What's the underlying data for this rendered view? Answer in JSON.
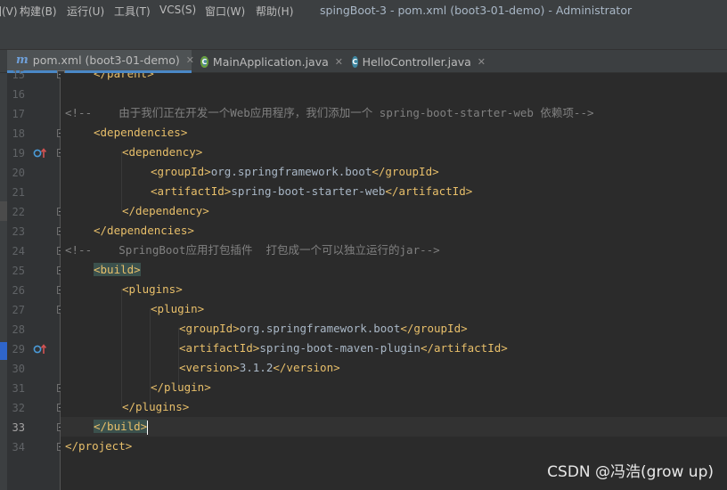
{
  "menu": [
    "图(V)",
    "构建(B)",
    "运行(U)",
    "工具(T)",
    "VCS(S)",
    "窗口(W)",
    "帮助(H)"
  ],
  "window_title": "spingBoot-3 - pom.xml (boot3-01-demo) - Administrator",
  "tabs": [
    {
      "label": "pom.xml (boot3-01-demo)",
      "icon": "maven-icon",
      "active": true
    },
    {
      "label": "MainApplication.java",
      "icon": "spring-class-icon",
      "active": false
    },
    {
      "label": "HelloController.java",
      "icon": "class-icon",
      "active": false
    }
  ],
  "gutter": {
    "lines": [
      "15",
      "16",
      "17",
      "18",
      "19",
      "20",
      "21",
      "22",
      "23",
      "24",
      "25",
      "26",
      "27",
      "28",
      "29",
      "30",
      "31",
      "32",
      "33",
      "34"
    ],
    "current_line": "33"
  },
  "code": {
    "l15": "</parent>",
    "l17": "<!--    由于我们正在开发一个Web应用程序，我们添加一个 spring-boot-starter-web 依赖项-->",
    "l18": "<dependencies>",
    "l19": "<dependency>",
    "l20_open": "<groupId>",
    "l20_val": "org.springframework.boot",
    "l20_close": "</groupId>",
    "l21_open": "<artifactId>",
    "l21_val": "spring-boot-starter-web",
    "l21_close": "</artifactId>",
    "l22": "</dependency>",
    "l23": "</dependencies>",
    "l24": "<!--    SpringBoot应用打包插件  打包成一个可以独立运行的jar-->",
    "l25": "<build>",
    "l26": "<plugins>",
    "l27": "<plugin>",
    "l28_open": "<groupId>",
    "l28_val": "org.springframework.boot",
    "l28_close": "</groupId>",
    "l29_open": "<artifactId>",
    "l29_val": "spring-boot-maven-plugin",
    "l29_close": "</artifactId>",
    "l30_open": "<version>",
    "l30_val": "3.1.2",
    "l30_close": "</version>",
    "l31": "</plugin>",
    "l32": "</plugins>",
    "l33": "</build>",
    "l34": "</project>"
  },
  "watermark": "CSDN @冯浩(grow up)",
  "colors": {
    "background": "#2b2b2b",
    "tag": "#e8bf6a",
    "text": "#a9b7c6",
    "comment": "#808080",
    "active_tab_underline": "#4a88c7"
  }
}
